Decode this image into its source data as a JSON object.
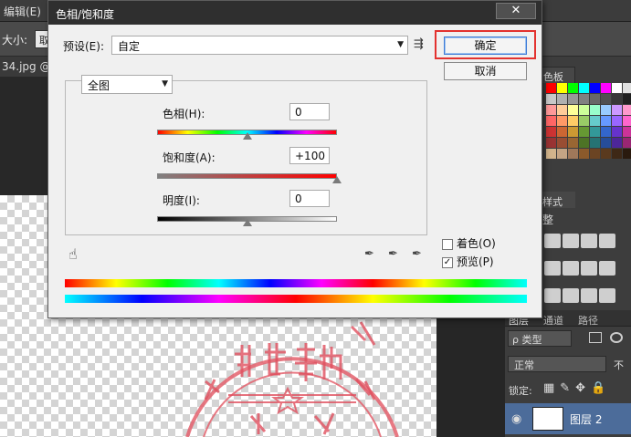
{
  "ps": {
    "menu_edit": "编辑(E)",
    "size_label": "大小:",
    "size_value": "取",
    "doc_tab": "34.jpg @",
    "swatch_tab": "色板",
    "styles_tab": "样式",
    "adjust_title": "整",
    "layers_tabs": [
      "图层",
      "通道",
      "路径"
    ],
    "filter_label": "ρ 类型",
    "blend_mode": "正常",
    "opacity_label": "不",
    "lock_label": "锁定:",
    "lock_glyphs": "▦✎✥🔒",
    "layer_name": "图层 2",
    "swatch_colors": [
      "#ff0000",
      "#ffff00",
      "#00ff00",
      "#00ffff",
      "#0000ff",
      "#ff00ff",
      "#ffffff",
      "#e0e0e0",
      "#c8c8c8",
      "#b0b0b0",
      "#989898",
      "#808080",
      "#686868",
      "#505050",
      "#383838",
      "#202020",
      "#ff9999",
      "#ffcc99",
      "#ffff99",
      "#ccff99",
      "#99ffcc",
      "#99ccff",
      "#cc99ff",
      "#ff99cc",
      "#ff6666",
      "#ff9966",
      "#ffcc66",
      "#99cc66",
      "#66cccc",
      "#6699ff",
      "#9966ff",
      "#ff66cc",
      "#cc3333",
      "#cc6633",
      "#cc9933",
      "#669933",
      "#339999",
      "#3366cc",
      "#6633cc",
      "#cc3399",
      "#993333",
      "#994d33",
      "#996633",
      "#4d7326",
      "#267373",
      "#264d99",
      "#4d2699",
      "#992673",
      "#d2b48c",
      "#c4a484",
      "#a0785a",
      "#8b5a2b",
      "#6b4423",
      "#5a3a1e",
      "#3e2816",
      "#2a1a0e"
    ]
  },
  "dialog": {
    "title": "色相/饱和度",
    "close_glyph": "✕",
    "preset_label": "预设(E):",
    "preset_value": "自定",
    "preset_menu_glyph": "⇶",
    "ok_label": "确定",
    "cancel_label": "取消",
    "edit_value": "全图",
    "hue_label": "色相(H):",
    "hue_value": "0",
    "hue_level": 0,
    "sat_label": "饱和度(A):",
    "sat_value": "+100",
    "sat_level": 100,
    "lum_label": "明度(I):",
    "lum_value": "0",
    "lum_level": 0,
    "hand_glyph": "☝",
    "dropper_glyph": "✒",
    "colorize_label": "着色(O)",
    "colorize_checked": false,
    "preview_label": "预览(P)",
    "preview_checked": true,
    "check_glyph": "✓"
  }
}
